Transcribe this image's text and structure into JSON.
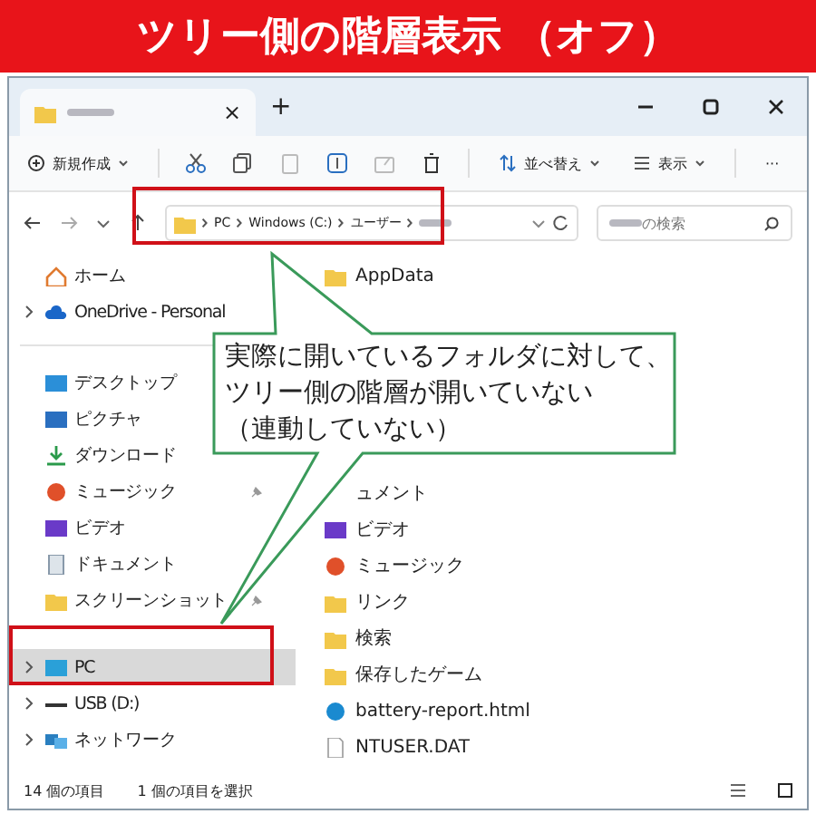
{
  "banner": {
    "title": "ツリー側の階層表示 （オフ）"
  },
  "tab": {
    "close": "×",
    "new_tab": "+"
  },
  "toolbar": {
    "new_button": "新規作成",
    "sort_button": "並べ替え",
    "view_button": "表示",
    "more_button": "···"
  },
  "address": {
    "crumbs": [
      "PC",
      "Windows (C:)",
      "ユーザー"
    ],
    "search_placeholder": "の検索"
  },
  "sidebar": {
    "items": [
      {
        "label": "ホーム",
        "kind": "home",
        "expandable": false,
        "pinned": false,
        "selected": false
      },
      {
        "label": "OneDrive - Personal",
        "kind": "cloud",
        "expandable": true,
        "pinned": false,
        "selected": false
      },
      {
        "label": "デスクトップ",
        "kind": "desktop",
        "expandable": false,
        "pinned": false,
        "selected": false
      },
      {
        "label": "ピクチャ",
        "kind": "pictures",
        "expandable": false,
        "pinned": false,
        "selected": false
      },
      {
        "label": "ダウンロード",
        "kind": "download",
        "expandable": false,
        "pinned": false,
        "selected": false
      },
      {
        "label": "ミュージック",
        "kind": "music",
        "expandable": false,
        "pinned": true,
        "selected": false
      },
      {
        "label": "ビデオ",
        "kind": "video",
        "expandable": false,
        "pinned": false,
        "selected": false
      },
      {
        "label": "ドキュメント",
        "kind": "document",
        "expandable": false,
        "pinned": false,
        "selected": false
      },
      {
        "label": "スクリーンショット",
        "kind": "folder",
        "expandable": false,
        "pinned": true,
        "selected": false
      },
      {
        "label": "PC",
        "kind": "pc",
        "expandable": true,
        "pinned": false,
        "selected": true
      },
      {
        "label": "USB (D:)",
        "kind": "drive",
        "expandable": true,
        "pinned": false,
        "selected": false
      },
      {
        "label": "ネットワーク",
        "kind": "network",
        "expandable": true,
        "pinned": false,
        "selected": false
      }
    ]
  },
  "files": [
    {
      "name": "AppData",
      "kind": "folder"
    },
    {
      "name": "ュメント"
    },
    {
      "name": "ビデオ",
      "kind": "video"
    },
    {
      "name": "ミュージック",
      "kind": "music"
    },
    {
      "name": "リンク",
      "kind": "folder"
    },
    {
      "name": "検索",
      "kind": "folder"
    },
    {
      "name": "保存したゲーム",
      "kind": "folder"
    },
    {
      "name": "battery-report.html",
      "kind": "edge"
    },
    {
      "name": "NTUSER.DAT",
      "kind": "file"
    }
  ],
  "status_bar": {
    "count": "14 個の項目",
    "selection": "1 個の項目を選択"
  },
  "callout": {
    "lines": [
      "実際に開いているフォルダに対して、",
      "ツリー側の階層が開いていない",
      "（連動していない）"
    ]
  }
}
